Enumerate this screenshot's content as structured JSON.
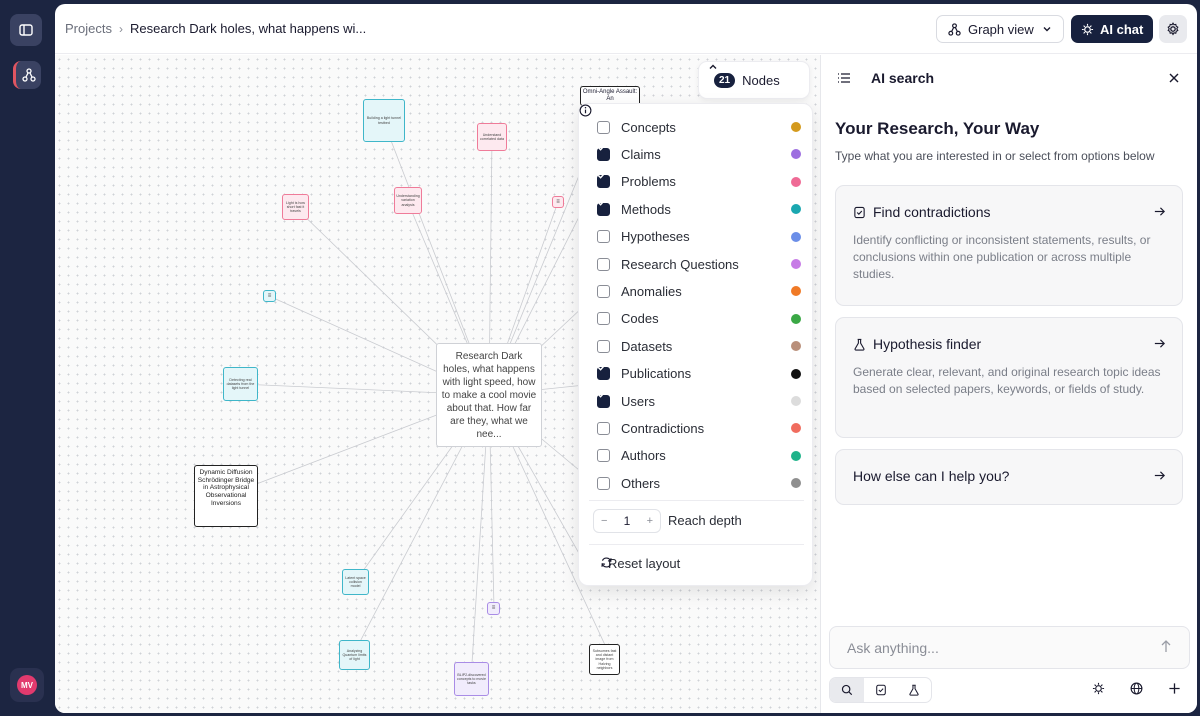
{
  "breadcrumb": {
    "root": "Projects",
    "separator": "›",
    "current": "Research Dark holes, what happens wi..."
  },
  "toolbar": {
    "graph_view_label": "Graph view",
    "ai_chat_label": "AI chat"
  },
  "sidebar": {
    "avatar_initials": "MV"
  },
  "graph": {
    "center_node": "Research Dark holes, what happens with light speed, how to make a cool movie about that. How far are they, what we nee...",
    "dynamic_node": "Dynamic Diffusion Schrödinger Bridge in Astrophysical Observational Inversions",
    "omni_node": "Omni-Angle Assault: An",
    "small_nodes": [
      "Building a light tunnel testbed",
      "Understand correlated data",
      "Light is how short fast it travels",
      "Understanding variation analysis",
      "Detecting real datasets from the light tunnel",
      "Latent space collision model",
      "Analyzing Quantum limits of light",
      "BLIP2-discovered concepts to movie tasks",
      "Subsumes fast and distant image from Halving neighbors"
    ]
  },
  "nodes_panel": {
    "count": "21",
    "label": "Nodes",
    "options": [
      {
        "label": "Concepts",
        "checked": false,
        "color": "#d49a1d"
      },
      {
        "label": "Claims",
        "checked": true,
        "color": "#9d6ee0"
      },
      {
        "label": "Problems",
        "checked": true,
        "color": "#ef6a95"
      },
      {
        "label": "Methods",
        "checked": true,
        "color": "#1aa7b0"
      },
      {
        "label": "Hypotheses",
        "checked": false,
        "color": "#6b8ee8"
      },
      {
        "label": "Research Questions",
        "checked": false,
        "color": "#c77be6"
      },
      {
        "label": "Anomalies",
        "checked": false,
        "color": "#f07a26"
      },
      {
        "label": "Codes",
        "checked": false,
        "color": "#3aa845"
      },
      {
        "label": "Datasets",
        "checked": false,
        "color": "#b98f7a"
      },
      {
        "label": "Publications",
        "checked": true,
        "color": "#111111"
      },
      {
        "label": "Users",
        "checked": true,
        "color": "#dcdcdc"
      },
      {
        "label": "Contradictions",
        "checked": false,
        "color": "#f06c5e"
      },
      {
        "label": "Authors",
        "checked": false,
        "color": "#1fb38a"
      },
      {
        "label": "Others",
        "checked": false,
        "color": "#8f8f8f"
      }
    ],
    "reach_depth_value": "1",
    "reach_depth_label": "Reach depth",
    "stepper_minus": "−",
    "stepper_plus": "+",
    "reset_label": "Reset layout"
  },
  "ai_panel": {
    "title": "AI search",
    "heading": "Your Research, Your Way",
    "subheading": "Type what you are interested in or select from options below",
    "cards": [
      {
        "title": "Find contradictions",
        "description": "Identify conflicting or inconsistent statements, results, or conclusions within one publication or across multiple studies."
      },
      {
        "title": "Hypothesis finder",
        "description": "Generate clear, relevant, and original research topic ideas based on selected papers, keywords, or fields of study."
      },
      {
        "title": "How else can I help you?",
        "description": ""
      }
    ],
    "ask_placeholder": "Ask anything..."
  }
}
